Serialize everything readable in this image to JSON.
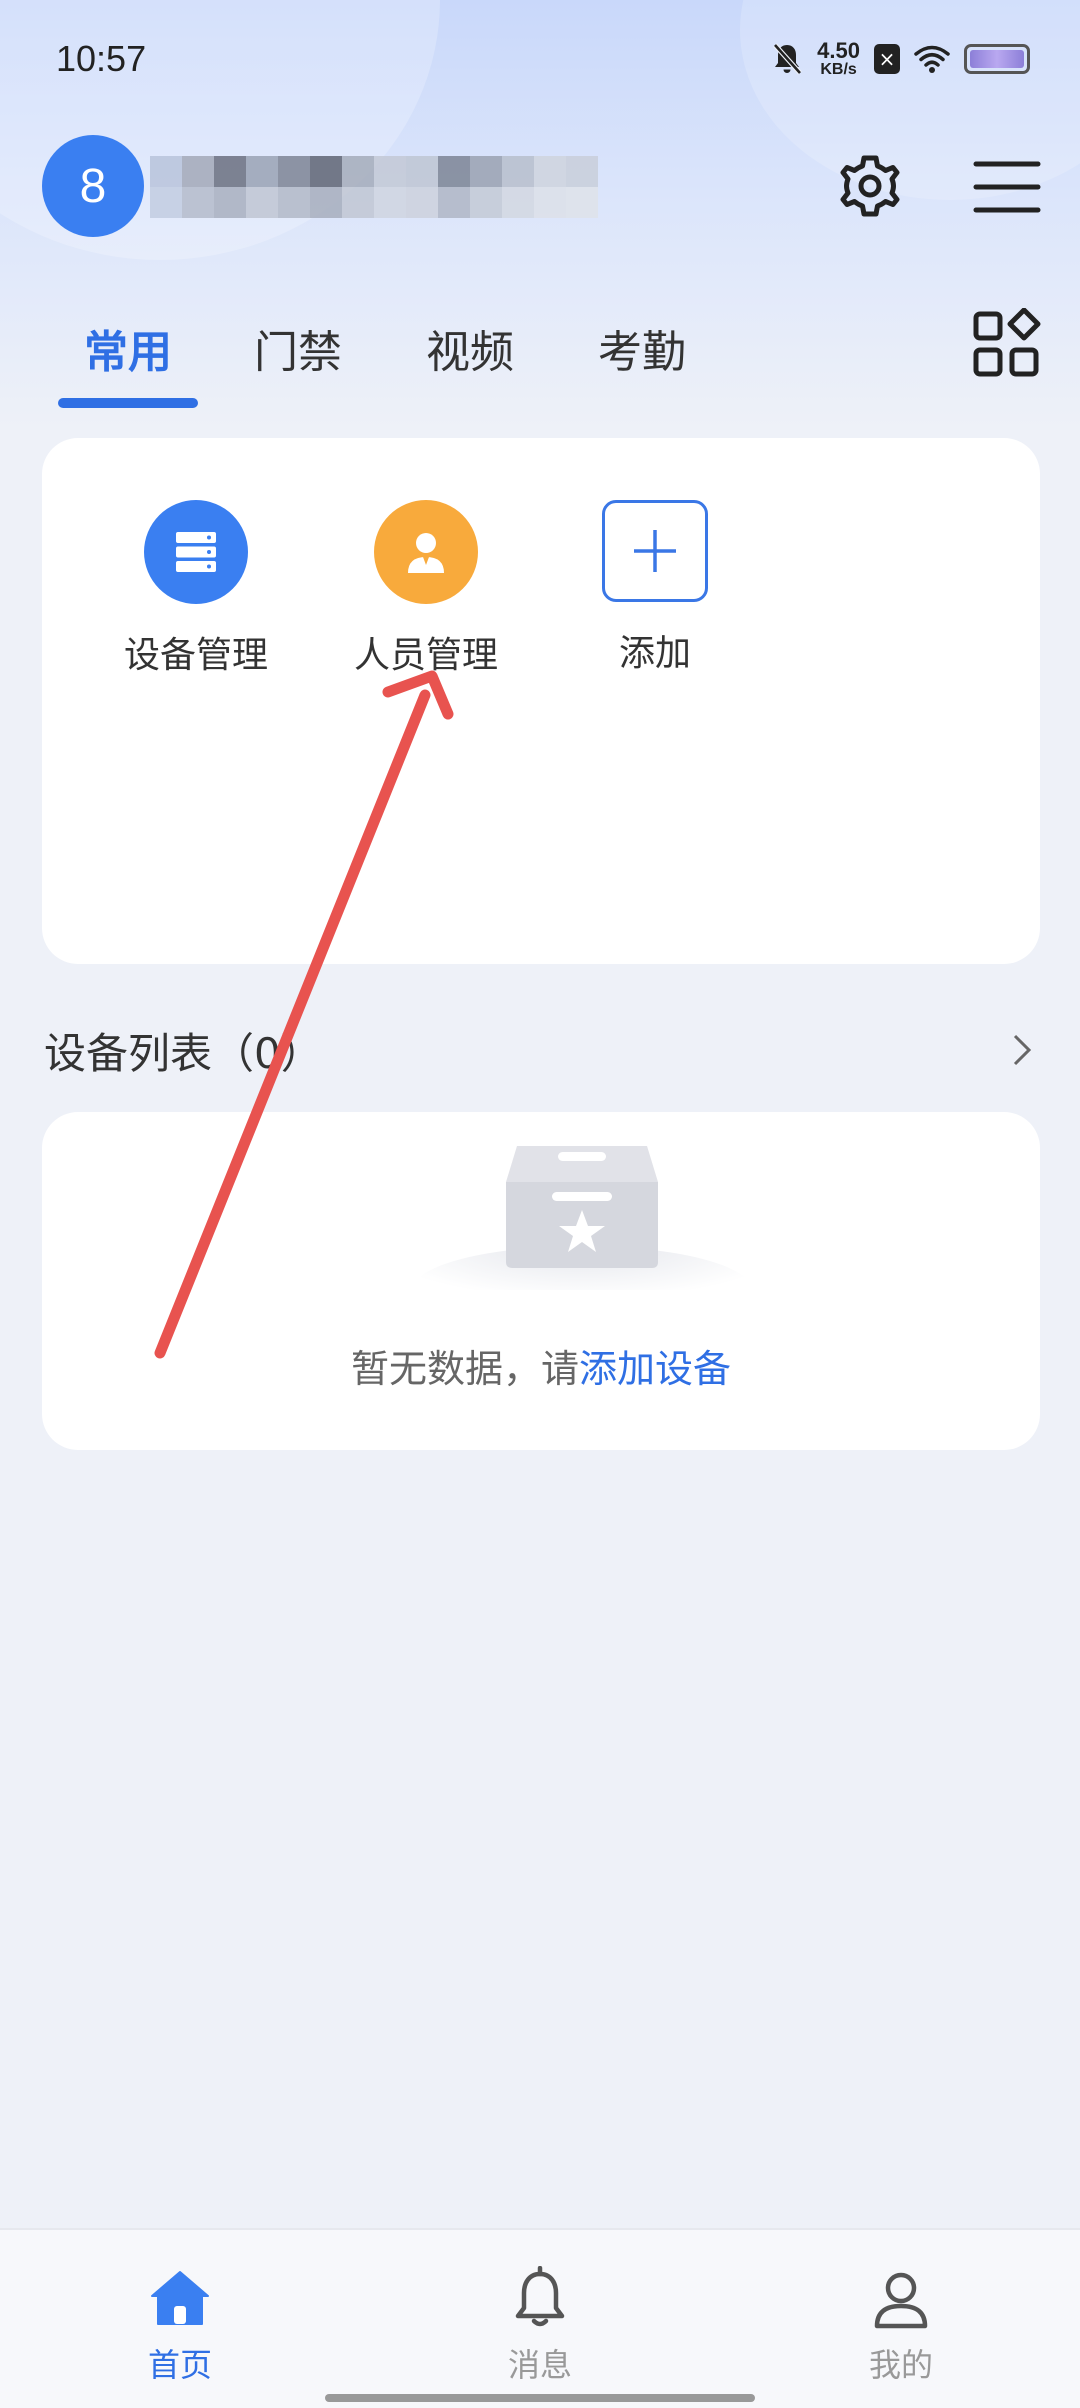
{
  "status_bar": {
    "time": "10:57",
    "net_speed_value": "4.50",
    "net_speed_unit": "KB/s",
    "sim_icon": "×",
    "icons": [
      "mute-bell-icon",
      "sim-no-service-icon",
      "wifi-icon",
      "battery-icon"
    ]
  },
  "header": {
    "avatar_text": "8",
    "username": "",
    "settings_icon": "gear-icon",
    "menu_icon": "hamburger-menu-icon"
  },
  "tabs": {
    "items": [
      "常用",
      "门禁",
      "视频",
      "考勤"
    ],
    "active_index": 0,
    "more_icon": "grid-apps-icon"
  },
  "quick_actions": {
    "items": [
      {
        "label": "设备管理",
        "icon": "server-stack-icon",
        "color": "#3a7ff1"
      },
      {
        "label": "人员管理",
        "icon": "person-icon",
        "color": "#f8aa3c"
      },
      {
        "label": "添加",
        "icon": "plus-icon",
        "color": "#3a77e6"
      }
    ]
  },
  "device_list": {
    "title": "设备列表（0）",
    "empty_text": "暂无数据，请",
    "empty_link": "添加设备"
  },
  "bottom_nav": {
    "items": [
      {
        "label": "首页",
        "icon": "home-icon"
      },
      {
        "label": "消息",
        "icon": "bell-icon"
      },
      {
        "label": "我的",
        "icon": "user-icon"
      }
    ],
    "active_index": 0
  },
  "colors": {
    "accent": "#2f6fe4",
    "annotation_arrow": "#e8534f"
  }
}
